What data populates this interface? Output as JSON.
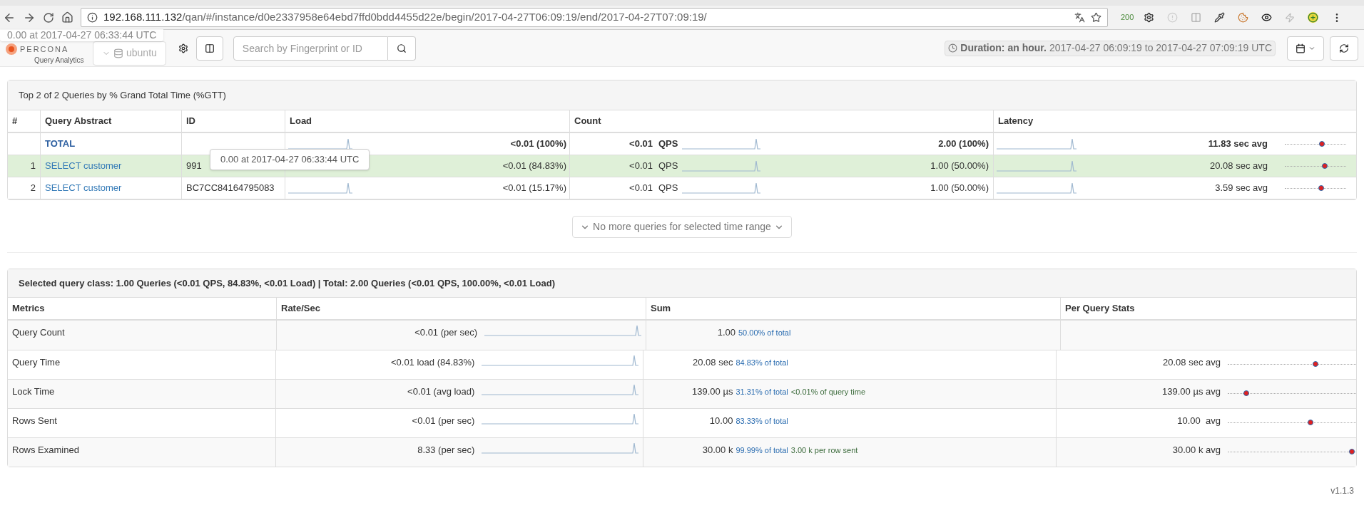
{
  "browser": {
    "url_host": "192.168.111.132",
    "url_path": "/qan/#/instance/d0e2337958e64ebd7ffd0bdd4455d22e/begin/2017-04-27T06:09:19/end/2017-04-27T07:09:19/",
    "badge": "200"
  },
  "header": {
    "tooltip": "0.00 at 2017-04-27 06:33:44 UTC",
    "logo": "PERCONA",
    "subtitle": "Query Analytics",
    "db": "ubuntu",
    "search_placeholder": "Search by Fingerprint or ID",
    "duration_label": "Duration: an hour.",
    "duration_range": "2017-04-27 06:09:19 to 2017-04-27 07:09:19 UTC"
  },
  "top_queries": {
    "title": "Top 2 of 2 Queries by % Grand Total Time (%GTT)",
    "columns": [
      "#",
      "Query Abstract",
      "ID",
      "Load",
      "Count",
      "Latency"
    ],
    "tooltip": "0.00 at 2017-04-27 06:33:44 UTC",
    "rows": [
      {
        "kind": "total",
        "rank": "",
        "abstract": "TOTAL",
        "id": "",
        "load": "<0.01 (100%)",
        "qps": "<0.01",
        "qps_unit": "QPS",
        "count": "2.00 (100%)",
        "latency": "11.83 sec avg",
        "level": 0.63,
        "selected": false
      },
      {
        "kind": "query",
        "rank": "1",
        "abstract": "SELECT customer",
        "id": "991",
        "load": "<0.01 (84.83%)",
        "qps": "<0.01",
        "qps_unit": "QPS",
        "count": "1.00 (50.00%)",
        "latency": "20.08 sec avg",
        "level": 0.69,
        "selected": true
      },
      {
        "kind": "query",
        "rank": "2",
        "abstract": "SELECT customer",
        "id": "BC7CC84164795083",
        "load": "<0.01 (15.17%)",
        "qps": "<0.01",
        "qps_unit": "QPS",
        "count": "1.00 (50.00%)",
        "latency": "3.59 sec avg",
        "level": 0.62,
        "selected": false
      }
    ]
  },
  "more_button": "No more queries for selected time range",
  "details": {
    "title": "Selected query class: 1.00 Queries (<0.01 QPS, 84.83%, <0.01 Load) | Total: 2.00 Queries (<0.01 QPS, 100.00%, <0.01 Load)",
    "columns": [
      "Metrics",
      "Rate/Sec",
      "Sum",
      "Per Query Stats"
    ],
    "rows": [
      {
        "metric": "Query Count",
        "rate": "<0.01 (per sec)",
        "sum": "1.00",
        "share": "50.00% of total"
      },
      {
        "metric": "Query Time",
        "rate": "<0.01 load (84.83%)",
        "sum": "20.08 sec",
        "share": "84.83% of total",
        "per_query": "20.08 sec avg",
        "level": 0.7
      },
      {
        "metric": "Lock Time",
        "rate": "<0.01 (avg load)",
        "sum": "139.00 µs",
        "share": "31.31% of total",
        "extra": "<0.01% of query time",
        "per_query": "139.00 µs avg",
        "level": 0.13
      },
      {
        "metric": "Rows Sent",
        "rate": "<0.01 (per sec)",
        "sum": "10.00",
        "share": "83.33% of total",
        "per_query": "10.00  avg",
        "level": 0.66
      },
      {
        "metric": "Rows Examined",
        "rate": "8.33 (per sec)",
        "sum": "30.00 k",
        "share": "99.99% of total",
        "extra": "3.00 k per row sent",
        "per_query": "30.00 k avg",
        "level": 1.0
      }
    ]
  },
  "version": "v1.1.3"
}
